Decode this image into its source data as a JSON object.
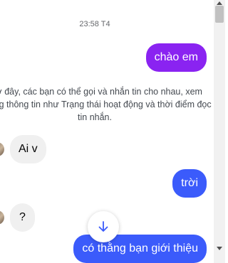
{
  "timestamp": "23:58 T4",
  "notice": "Giờ đây, các bạn có thể gọi và nhắn tin cho nhau, xem những thông tin như Trạng thái hoạt động và thời điểm đọc tin nhắn.",
  "messages": [
    {
      "text": "chào em",
      "direction": "outgoing"
    },
    {
      "text": "Ai v",
      "direction": "incoming"
    },
    {
      "text": "trời",
      "direction": "outgoing"
    },
    {
      "text": "?",
      "direction": "incoming"
    },
    {
      "text": "có thằng bạn giới thiệu",
      "direction": "outgoing"
    }
  ],
  "icons": {
    "scroll_down": "arrow-down-icon",
    "scroll_up_arrow": "scrollbar-up-arrow-icon",
    "scroll_down_arrow": "scrollbar-down-arrow-icon"
  },
  "colors": {
    "outgoing_purple": "#8a23f1",
    "outgoing_blue": "#3b5bfb",
    "incoming": "#f0f0f0",
    "accent": "#3b5bfb"
  }
}
